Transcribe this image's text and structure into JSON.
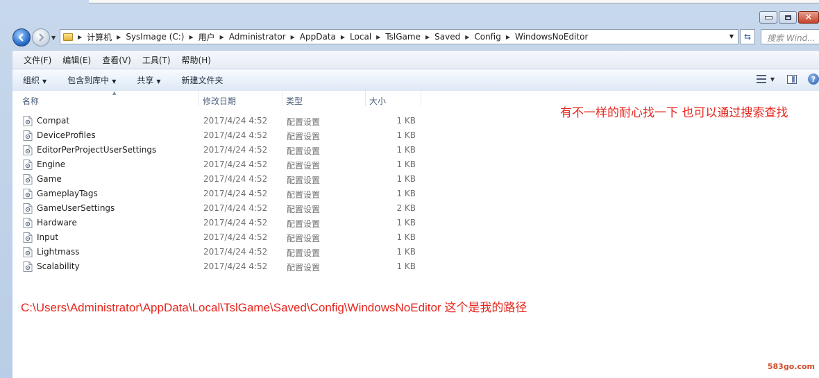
{
  "address": {
    "crumbs": [
      "计算机",
      "SysImage (C:)",
      "用户",
      "Administrator",
      "AppData",
      "Local",
      "TslGame",
      "Saved",
      "Config",
      "WindowsNoEditor"
    ],
    "search_placeholder": "搜索 Wind..."
  },
  "menu": {
    "items": [
      "文件(F)",
      "编辑(E)",
      "查看(V)",
      "工具(T)",
      "帮助(H)"
    ]
  },
  "toolbar": {
    "organize": "组织",
    "include_in_library": "包含到库中",
    "share": "共享",
    "new_folder": "新建文件夹"
  },
  "columns": {
    "name": "名称",
    "modified": "修改日期",
    "type": "类型",
    "size": "大小"
  },
  "files": [
    {
      "name": "Compat",
      "modified": "2017/4/24 4:52",
      "type": "配置设置",
      "size": "1 KB"
    },
    {
      "name": "DeviceProfiles",
      "modified": "2017/4/24 4:52",
      "type": "配置设置",
      "size": "1 KB"
    },
    {
      "name": "EditorPerProjectUserSettings",
      "modified": "2017/4/24 4:52",
      "type": "配置设置",
      "size": "1 KB"
    },
    {
      "name": "Engine",
      "modified": "2017/4/24 4:52",
      "type": "配置设置",
      "size": "1 KB"
    },
    {
      "name": "Game",
      "modified": "2017/4/24 4:52",
      "type": "配置设置",
      "size": "1 KB"
    },
    {
      "name": "GameplayTags",
      "modified": "2017/4/24 4:52",
      "type": "配置设置",
      "size": "1 KB"
    },
    {
      "name": "GameUserSettings",
      "modified": "2017/4/24 4:52",
      "type": "配置设置",
      "size": "2 KB"
    },
    {
      "name": "Hardware",
      "modified": "2017/4/24 4:52",
      "type": "配置设置",
      "size": "1 KB"
    },
    {
      "name": "Input",
      "modified": "2017/4/24 4:52",
      "type": "配置设置",
      "size": "1 KB"
    },
    {
      "name": "Lightmass",
      "modified": "2017/4/24 4:52",
      "type": "配置设置",
      "size": "1 KB"
    },
    {
      "name": "Scalability",
      "modified": "2017/4/24 4:52",
      "type": "配置设置",
      "size": "1 KB"
    }
  ],
  "annotations": {
    "tip": "有不一样的耐心找一下 也可以通过搜索查找",
    "path": "C:\\Users\\Administrator\\AppData\\Local\\TslGame\\Saved\\Config\\WindowsNoEditor 这个是我的路径"
  },
  "watermark": "583go.com",
  "colors": {
    "annotation": "#e6251d",
    "close_button": "#c5412a"
  }
}
